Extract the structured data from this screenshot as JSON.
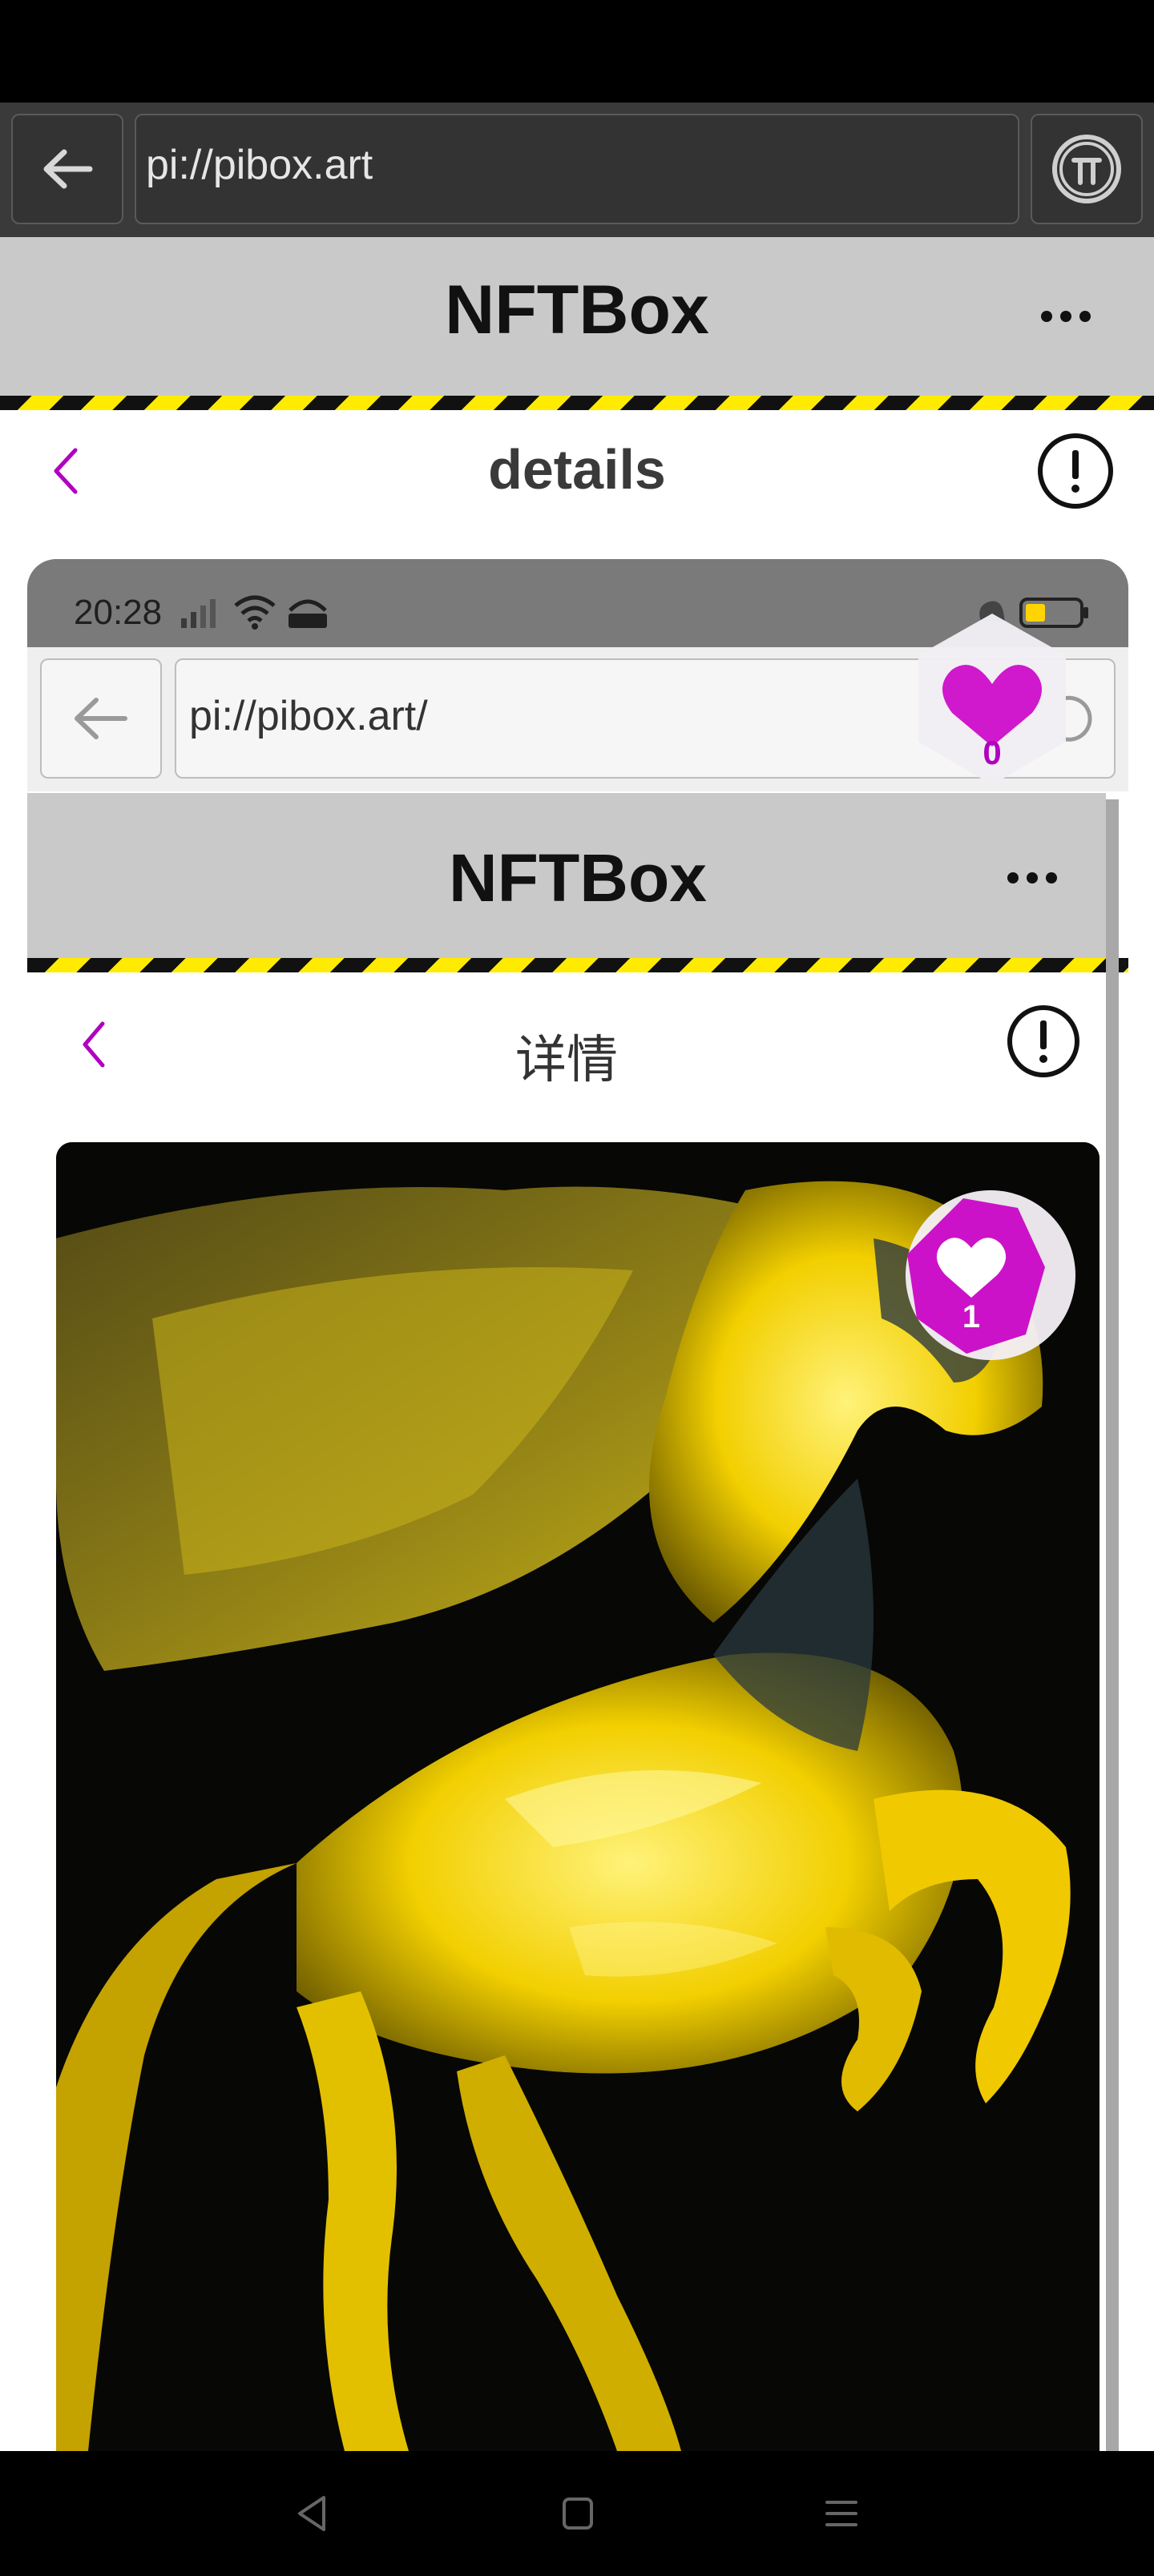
{
  "browser": {
    "url": "pi://pibox.art"
  },
  "app": {
    "title": "NFTBox",
    "details_title": "details"
  },
  "embedded": {
    "time": "20:28",
    "url": "pi://pibox.art/",
    "title": "NFTBox",
    "details_title": "详情"
  },
  "likes": {
    "top_badge_count": "0",
    "image_badge_count": "1"
  },
  "colors": {
    "accent": "#b000c0",
    "hazard_yellow": "#ffeb00",
    "header_gray": "#c9c9c9"
  }
}
